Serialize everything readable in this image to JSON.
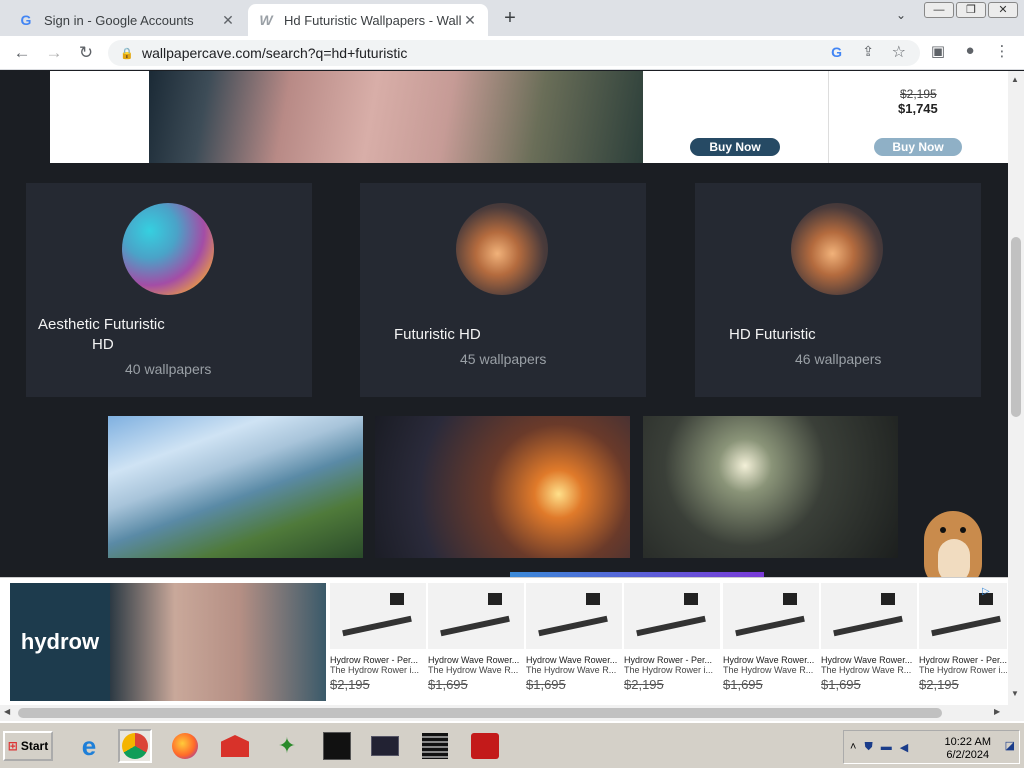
{
  "browser": {
    "tabs": [
      {
        "title": "Sign in - Google Accounts",
        "favicon": "google-g-icon",
        "active": false
      },
      {
        "title": "Hd Futuristic Wallpapers - Wallp",
        "favicon": "wallpapercave-w-icon",
        "active": true
      }
    ],
    "url": "wallpapercave.com/search?q=hd+futuristic"
  },
  "top_ad": {
    "buy_label_1": "Buy Now",
    "buy_label_2": "Buy Now",
    "price_old": "$2,195",
    "price_new": "$1,745"
  },
  "categories": [
    {
      "name_line1": "Aesthetic Futuristic",
      "name_line2": "HD",
      "count": "40 wallpapers"
    },
    {
      "name_line1": "Futuristic HD",
      "name_line2": "",
      "count": "45 wallpapers"
    },
    {
      "name_line1": "HD Futuristic",
      "name_line2": "",
      "count": "46 wallpapers"
    }
  ],
  "bottom_ad": {
    "brand": "hydrow",
    "products": [
      {
        "name": "Hydrow Rower - Per...",
        "desc": "The Hydrow Rower i...",
        "price": "$2,195"
      },
      {
        "name": "Hydrow Wave Rower...",
        "desc": "The Hydrow Wave R...",
        "price": "$1,695"
      },
      {
        "name": "Hydrow Wave Rower...",
        "desc": "The Hydrow Wave R...",
        "price": "$1,695"
      },
      {
        "name": "Hydrow Rower - Per...",
        "desc": "The Hydrow Rower i...",
        "price": "$2,195"
      },
      {
        "name": "Hydrow Wave Rower...",
        "desc": "The Hydrow Wave R...",
        "price": "$1,695"
      },
      {
        "name": "Hydrow Wave Rower...",
        "desc": "The Hydrow Wave R...",
        "price": "$1,695"
      },
      {
        "name": "Hydrow Rower - Per...",
        "desc": "The Hydrow Rower i...",
        "price": "$2,195"
      }
    ]
  },
  "taskbar": {
    "start_label": "Start",
    "time": "10:22 AM",
    "date": "6/2/2024"
  },
  "colors": {
    "page_bg": "#1b1e23",
    "card_bg": "#252932",
    "buy_button": "#264a64",
    "hydrow_brand": "#1d3b4d"
  }
}
